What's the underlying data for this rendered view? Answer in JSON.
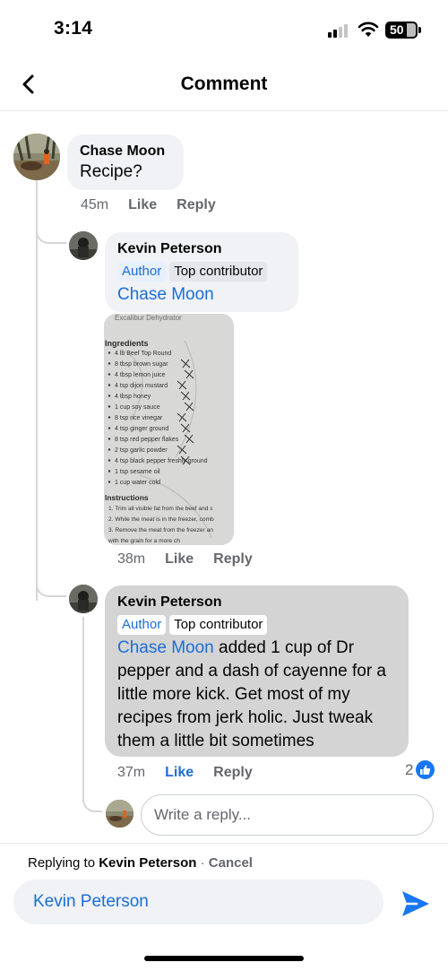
{
  "status_bar": {
    "time": "3:14",
    "battery": "50"
  },
  "header": {
    "title": "Comment"
  },
  "comments": [
    {
      "author": "Chase Moon",
      "text": "Recipe?",
      "time": "45m",
      "like_label": "Like",
      "reply_label": "Reply"
    },
    {
      "author": "Kevin Peterson",
      "badge_author": "Author",
      "badge_contributor": "Top contributor",
      "mention": "Chase Moon",
      "time": "38m",
      "like_label": "Like",
      "reply_label": "Reply",
      "photo": {
        "top_text": "Excalibur Dehydrator",
        "heading": "Ingredients",
        "items": [
          "4 lb Beef Top Round",
          "8 tbsp brown sugar",
          "4 tbsp lemon juice",
          "4 tsp dijon mustard",
          "4 tbsp honey",
          "1 cup soy sauce",
          "8 tsp rice vinegar",
          "4 tsp ginger ground",
          "8 tsp red pepper flakes",
          "2 tsp garlic powder",
          "4 tsp black pepper freshly ground",
          "1 tsp sesame oil",
          "1 cup water cold"
        ],
        "heading2": "Instructions",
        "steps": [
          "1. Trim all visible fat from the beef and s",
          "2. While the meat is in the freezer, comb",
          "3. Remove the meat from the freezer an",
          "with the grain for a more ch"
        ]
      }
    },
    {
      "author": "Kevin Peterson",
      "badge_author": "Author",
      "badge_contributor": "Top contributor",
      "mention": "Chase Moon",
      "text": " added 1 cup of Dr pepper and a dash of cayenne for a little more kick.   Get most of my recipes from jerk holic. Just tweak them a little bit sometimes",
      "time": "37m",
      "like_label": "Like",
      "reply_label": "Reply",
      "reaction_count": "2"
    }
  ],
  "reply_box": {
    "placeholder": "Write a reply..."
  },
  "composer": {
    "replying_prefix": "Replying to ",
    "replying_name": "Kevin Peterson",
    "separator": " · ",
    "cancel_label": "Cancel",
    "input_value": "Kevin Peterson"
  },
  "colors": {
    "accent": "#1a6ed8",
    "like_blue": "#1877f2",
    "bubble": "#f0f2f5",
    "selected_bubble": "#d4d4d4"
  }
}
